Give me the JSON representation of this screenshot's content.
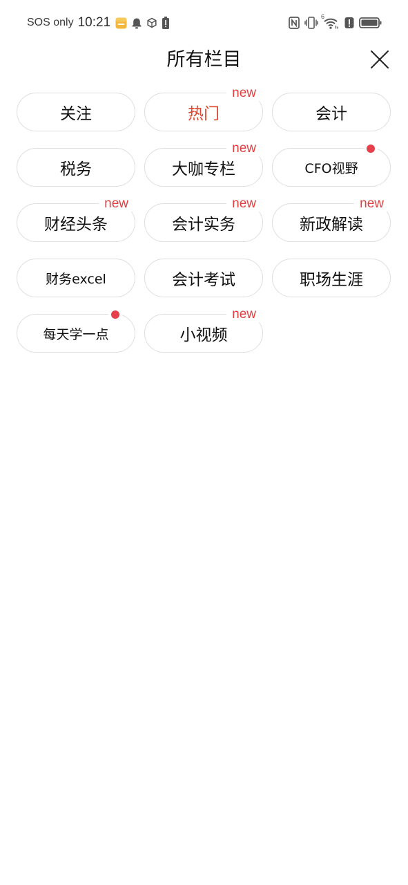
{
  "status_bar": {
    "carrier": "SOS only",
    "time": "10:21",
    "left_icons": [
      "sticky-note-icon",
      "bell-icon",
      "cube-icon",
      "battery-alert-icon"
    ],
    "right_icons": [
      "nfc-icon",
      "vibrate-icon",
      "wifi-icon",
      "alert-icon",
      "battery-icon"
    ],
    "wifi_label": "6"
  },
  "header": {
    "title": "所有栏目",
    "close_icon": "close-icon"
  },
  "colors": {
    "accent": "#e0452e",
    "badge_red": "#e04040",
    "chip_border": "#dedede",
    "text": "#111111"
  },
  "channels": [
    {
      "label": "关注",
      "badge": "none",
      "active": false
    },
    {
      "label": "热门",
      "badge": "new",
      "active": true
    },
    {
      "label": "会计",
      "badge": "none",
      "active": false
    },
    {
      "label": "税务",
      "badge": "none",
      "active": false
    },
    {
      "label": "大咖专栏",
      "badge": "new",
      "active": false
    },
    {
      "label": "CFO视野",
      "badge": "dot",
      "active": false
    },
    {
      "label": "财经头条",
      "badge": "new",
      "active": false
    },
    {
      "label": "会计实务",
      "badge": "new",
      "active": false
    },
    {
      "label": "新政解读",
      "badge": "new",
      "active": false
    },
    {
      "label": "财务excel",
      "badge": "none",
      "active": false
    },
    {
      "label": "会计考试",
      "badge": "none",
      "active": false
    },
    {
      "label": "职场生涯",
      "badge": "none",
      "active": false
    },
    {
      "label": "每天学一点",
      "badge": "dot",
      "active": false
    },
    {
      "label": "小视频",
      "badge": "new",
      "active": false
    }
  ],
  "badge_text": "new"
}
